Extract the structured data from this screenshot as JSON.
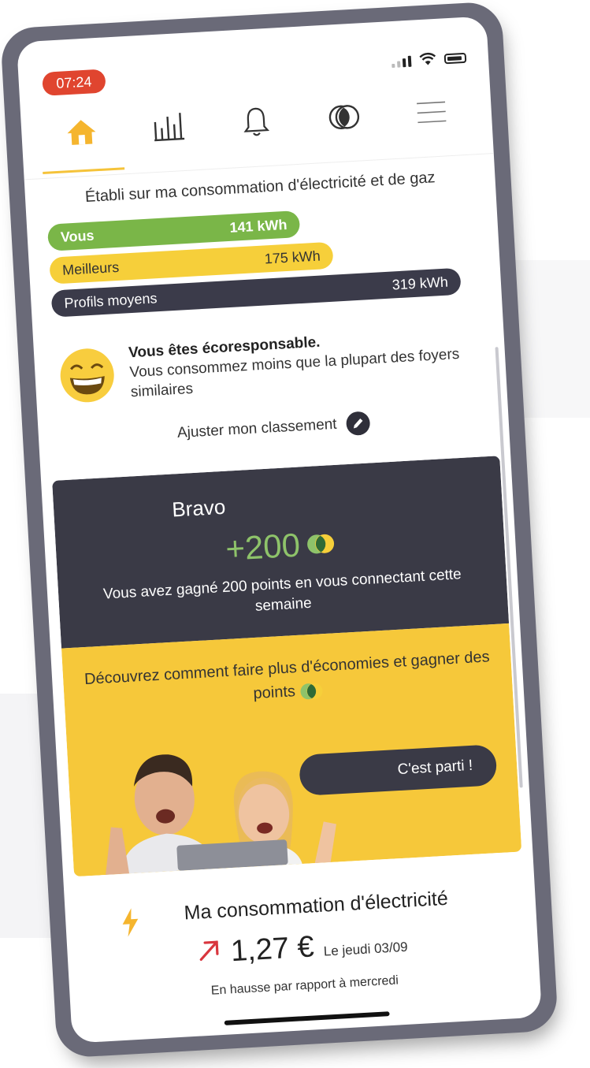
{
  "status_bar": {
    "time": "07:24"
  },
  "nav": {
    "items": [
      {
        "name": "home",
        "icon": "home-icon",
        "active": true
      },
      {
        "name": "stats",
        "icon": "bar-chart-icon",
        "active": false
      },
      {
        "name": "notifications",
        "icon": "bell-icon",
        "active": false
      },
      {
        "name": "points",
        "icon": "coin-icon",
        "active": false
      },
      {
        "name": "menu",
        "icon": "hamburger-menu-icon",
        "active": false
      }
    ]
  },
  "comparison": {
    "intro": "Établi sur ma consommation d'électricité et de gaz",
    "bars": [
      {
        "label": "Vous",
        "value": "141 kWh",
        "color": "#7ab648"
      },
      {
        "label": "Meilleurs",
        "value": "175 kWh",
        "color": "#f6cf3a"
      },
      {
        "label": "Profils moyens",
        "value": "319 kWh",
        "color": "#3b3b4a"
      }
    ],
    "status_title": "Vous êtes écoresponsable.",
    "status_text": "Vous consommez moins que la plupart des foyers similaires",
    "adjust_label": "Ajuster mon classement"
  },
  "reward": {
    "title": "Bravo",
    "points": "+200",
    "message": "Vous avez gagné 200 points en vous connectant cette semaine",
    "discover": "Découvrez comment faire plus d'économies et gagner des points",
    "cta_label": "C'est parti !"
  },
  "consumption": {
    "title": "Ma consommation d'électricité",
    "value": "1,27 €",
    "date": "Le jeudi 03/09",
    "note": "En hausse par rapport à mercredi",
    "trend": "up",
    "trend_color": "#d9363e"
  }
}
